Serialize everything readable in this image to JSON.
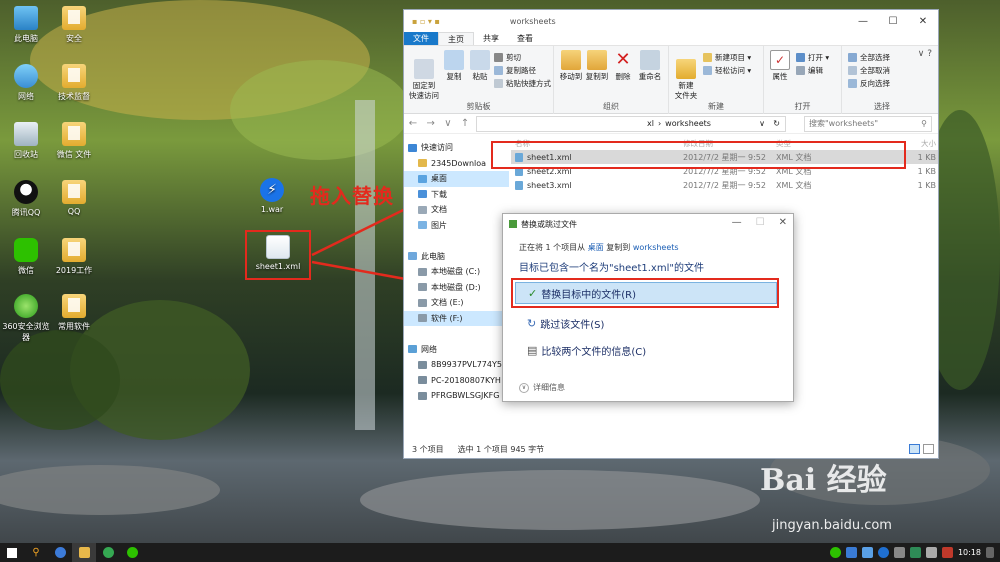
{
  "desktop": {
    "icons_left": [
      {
        "label": "此电脑",
        "icon": "computer-icon"
      },
      {
        "label": "网络",
        "icon": "network-icon"
      },
      {
        "label": "回收站",
        "icon": "recycle-bin-icon"
      },
      {
        "label": "腾讯QQ",
        "icon": "qq-icon"
      },
      {
        "label": "微信",
        "icon": "wechat-icon"
      },
      {
        "label": "360安全浏览器",
        "icon": "browser-360-icon"
      }
    ],
    "icons_mid": [
      {
        "label": "安全",
        "icon": "folder-icon"
      },
      {
        "label": "技术监督",
        "icon": "folder-icon"
      },
      {
        "label": "微信 文件",
        "icon": "folder-icon"
      },
      {
        "label": "QQ",
        "icon": "folder-icon"
      },
      {
        "label": "2019工作",
        "icon": "folder-icon"
      },
      {
        "label": "常用软件",
        "icon": "folder-icon"
      }
    ],
    "war_icon_label": "1.war",
    "xml_icon_label": "sheet1.xml",
    "annotation": "拖入替换"
  },
  "explorer": {
    "title": "worksheets",
    "tabs": [
      "文件",
      "主页",
      "共享",
      "查看"
    ],
    "ribbon": {
      "clipboard": {
        "pin": "固定到\n快速访问",
        "copy": "复制",
        "paste": "粘贴",
        "cut": "剪切",
        "copy_path": "复制路径",
        "paste_shortcut": "粘贴快捷方式",
        "group": "剪贴板"
      },
      "organize": {
        "move_to": "移动到",
        "copy_to": "复制到",
        "delete": "删除",
        "rename": "重命名",
        "group": "组织"
      },
      "new": {
        "new_folder": "新建\n文件夹",
        "new_item": "新建项目 ▾",
        "easy_access": "轻松访问 ▾",
        "group": "新建"
      },
      "open": {
        "properties": "属性",
        "open": "打开 ▾",
        "edit": "编辑",
        "group": "打开"
      },
      "select": {
        "select_all": "全部选择",
        "select_none": "全部取消",
        "invert": "反向选择",
        "group": "选择"
      }
    },
    "address": {
      "path_xl": "xl",
      "path_ws": "worksheets",
      "search_placeholder": "搜索\"worksheets\""
    },
    "nav": [
      {
        "label": "快速访问",
        "sel": false
      },
      {
        "label": "2345Downloa",
        "sel": false
      },
      {
        "label": "桌面",
        "sel": true
      },
      {
        "label": "下载",
        "sel": false
      },
      {
        "label": "文档",
        "sel": false
      },
      {
        "label": "图片",
        "sel": false
      },
      {
        "label": "",
        "sel": false
      },
      {
        "label": "此电脑",
        "sel": false
      },
      {
        "label": "本地磁盘 (C:)",
        "sel": false
      },
      {
        "label": "本地磁盘 (D:)",
        "sel": false
      },
      {
        "label": "文档 (E:)",
        "sel": false
      },
      {
        "label": "软件 (F:)",
        "sel": true
      },
      {
        "label": "",
        "sel": false
      },
      {
        "label": "网络",
        "sel": false
      },
      {
        "label": "8B9937PVL774Y5",
        "sel": false
      },
      {
        "label": "PC-20180807KYH",
        "sel": false
      },
      {
        "label": "PFRGBWLSGJKFG",
        "sel": false
      }
    ],
    "columns": [
      "名称",
      "修改日期",
      "类型",
      "大小"
    ],
    "files": [
      {
        "name": "sheet1.xml",
        "date": "2012/7/2 星期一 9:52",
        "type": "XML 文档",
        "size": "1 KB"
      },
      {
        "name": "sheet2.xml",
        "date": "2012/7/2 星期一 9:52",
        "type": "XML 文档",
        "size": "1 KB"
      },
      {
        "name": "sheet3.xml",
        "date": "2012/7/2 星期一 9:52",
        "type": "XML 文档",
        "size": "1 KB"
      }
    ],
    "status": {
      "count": "3 个项目",
      "selected": "选中 1 个项目  945 字节"
    }
  },
  "dialog": {
    "title": "替换或跳过文件",
    "info_pre": "正在将 1 个项目从",
    "info_src": "桌面",
    "info_mid": "复制到",
    "info_dst": "worksheets",
    "message": "目标已包含一个名为\"sheet1.xml\"的文件",
    "options": [
      "替换目标中的文件(R)",
      "跳过该文件(S)",
      "比较两个文件的信息(C)"
    ],
    "details": "详细信息"
  },
  "taskbar": {
    "time": "10:18"
  },
  "watermark": {
    "brand": "Bai 经验",
    "url": "jingyan.baidu.com"
  }
}
